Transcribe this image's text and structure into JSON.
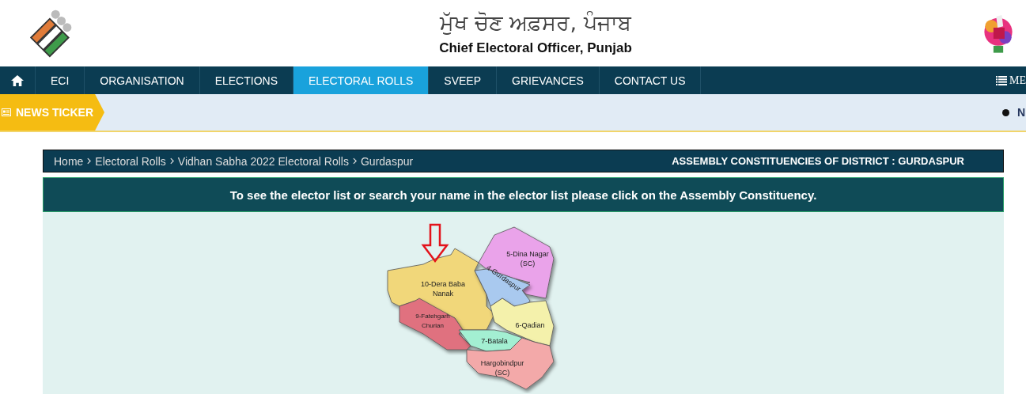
{
  "header": {
    "title_punjabi": "ਮੁੱਖ ਚੋਣ ਅਫ਼ਸਰ, ਪੰਜਾਬ",
    "title_english": "Chief Electoral Officer, Punjab"
  },
  "nav": {
    "items": [
      {
        "label": "ECI",
        "selected": false
      },
      {
        "label": "ORGANISATION",
        "selected": false
      },
      {
        "label": "ELECTIONS",
        "selected": false
      },
      {
        "label": "ELECTORAL ROLLS",
        "selected": true
      },
      {
        "label": "SVEEP",
        "selected": false
      },
      {
        "label": "GRIEVANCES",
        "selected": false
      },
      {
        "label": "CONTACT US",
        "selected": false
      }
    ],
    "menu_label": "ME"
  },
  "news_ticker": {
    "label": "NEWS TICKER",
    "item": "N"
  },
  "breadcrumb": [
    "Home",
    "Electoral Rolls",
    "Vidhan Sabha 2022 Electoral Rolls",
    "Gurdaspur"
  ],
  "section_title": "ASSEMBLY CONSTITUENCIES OF DISTRICT : GURDASPUR",
  "instruction": "To see the elector list or search your name in the elector list please click on the Assembly Constituency.",
  "map": {
    "constituencies": [
      {
        "lines": [
          "10-Dera Baba",
          "Nanak"
        ],
        "color": "#f1d77a"
      },
      {
        "lines": [
          "5-Dina Nagar",
          "(SC)"
        ],
        "color": "#eaa3ea"
      },
      {
        "lines": [
          "4-Gurdaspur"
        ],
        "color": "#a9c9ef"
      },
      {
        "lines": [
          "6-Qadian"
        ],
        "color": "#f4f1ab"
      },
      {
        "lines": [
          "9-Fatehgarh",
          "Churian"
        ],
        "color": "#e0717f"
      },
      {
        "lines": [
          "7-Batala"
        ],
        "color": "#a3efd2"
      },
      {
        "lines": [
          "Hargobindpur",
          "(SC)"
        ],
        "color": "#f3a9a9"
      }
    ]
  }
}
